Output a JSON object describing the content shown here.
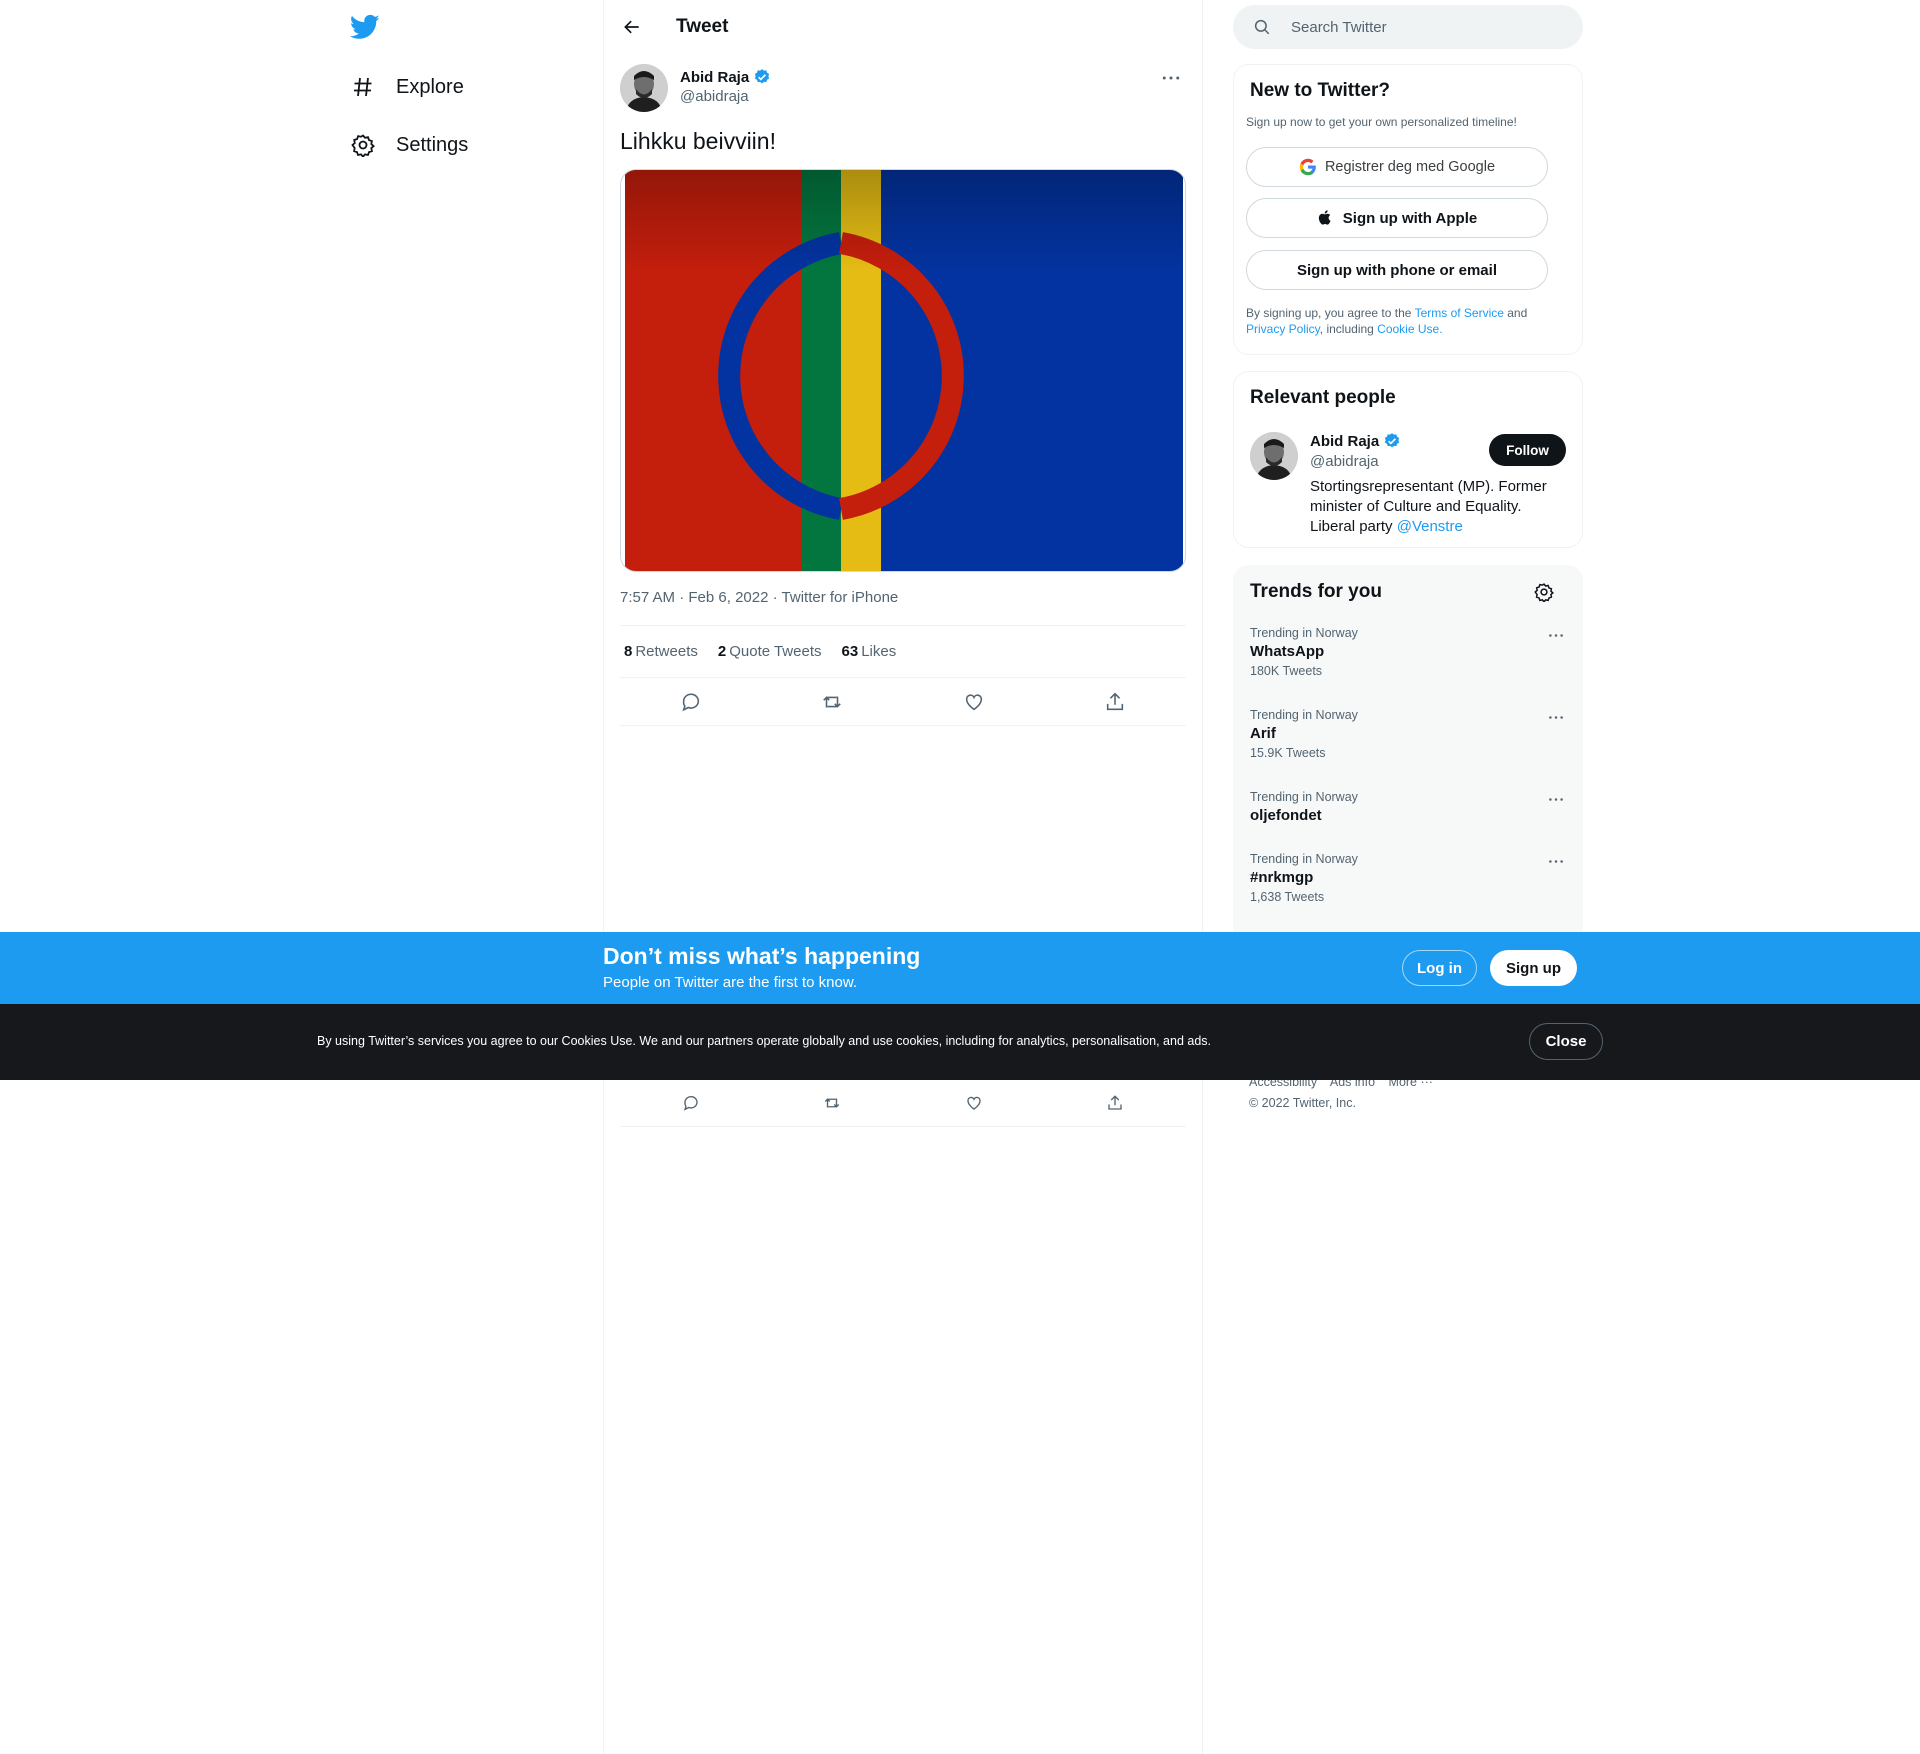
{
  "nav": {
    "logo": "twitter-bird-icon",
    "items": [
      {
        "label": "Explore",
        "icon": "hashtag-icon"
      },
      {
        "label": "Settings",
        "icon": "gear-icon"
      }
    ]
  },
  "header": {
    "title": "Tweet"
  },
  "tweet": {
    "author_name": "Abid Raja",
    "author_handle": "@abidraja",
    "text": "Lihkku beivviin!",
    "time": "7:57 AM",
    "date": "Feb 6, 2022",
    "source": "Twitter for iPhone",
    "separator": "·",
    "stats": {
      "retweets_count": "8",
      "retweets_label": "Retweets",
      "quotes_count": "2",
      "quotes_label": "Quote Tweets",
      "likes_count": "63",
      "likes_label": "Likes"
    }
  },
  "search": {
    "placeholder": "Search Twitter"
  },
  "signup_card": {
    "title": "New to Twitter?",
    "subtitle": "Sign up now to get your own personalized timeline!",
    "google_label": "Registrer deg med Google",
    "apple_label": "Sign up with Apple",
    "phone_label": "Sign up with phone or email",
    "legal_1": "By signing up, you agree to the ",
    "terms": "Terms of Service",
    "legal_2": " and ",
    "privacy": "Privacy Policy",
    "legal_3": ", including ",
    "cookie": "Cookie Use."
  },
  "people_card": {
    "title": "Relevant people",
    "name": "Abid Raja",
    "handle": "@abidraja",
    "bio": "Stortingsrepresentant (MP). Former minister of Culture and Equality. Liberal party ",
    "bio_link": "@Venstre",
    "follow_label": "Follow"
  },
  "trends_card": {
    "title": "Trends for you",
    "trends": [
      {
        "context": "Trending in Norway",
        "name": "WhatsApp",
        "count": "180K Tweets"
      },
      {
        "context": "Trending in Norway",
        "name": "Arif",
        "count": "15.9K Tweets"
      },
      {
        "context": "Trending in Norway",
        "name": "oljefondet",
        "count": ""
      },
      {
        "context": "Trending in Norway",
        "name": "#nrkmgp",
        "count": "1,638 Tweets"
      }
    ]
  },
  "footer": {
    "links": [
      "Accessibility",
      "Ads info",
      "More ···"
    ],
    "copyright": "© 2022 Twitter, Inc."
  },
  "banner": {
    "title": "Don’t miss what’s happening",
    "subtitle": "People on Twitter are the first to know.",
    "login_label": "Log in",
    "signup_label": "Sign up"
  },
  "cookies": {
    "text": "By using Twitter’s services you agree to our Cookies Use. We and our partners operate globally and use cookies, including for analytics, personalisation, and ads.",
    "close_label": "Close"
  },
  "colors": {
    "brand": "#1d9bf0",
    "text": "#0f1419",
    "secondary": "#536471",
    "dark_bar": "#16181c"
  }
}
